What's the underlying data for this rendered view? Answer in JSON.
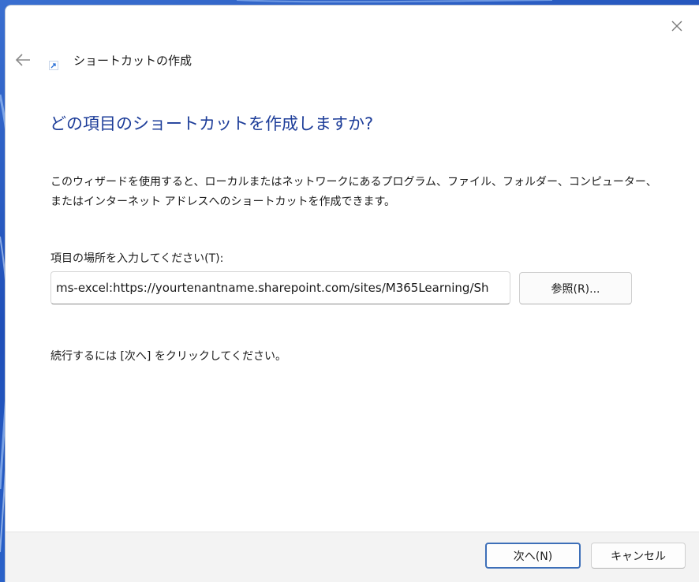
{
  "window": {
    "title": "ショートカットの作成",
    "close_icon": "close-icon",
    "back_icon": "back-arrow-icon",
    "title_icon": "shortcut-icon"
  },
  "main": {
    "heading": "どの項目のショートカットを作成しますか?",
    "description": "このウィザードを使用すると、ローカルまたはネットワークにあるプログラム、ファイル、フォルダー、コンピューター、またはインターネット アドレスへのショートカットを作成できます。",
    "location_label": "項目の場所を入力してください(T):",
    "location_value": "ms-excel:https://yourtenantname.sharepoint.com/sites/M365Learning/Sh",
    "browse_label": "参照(R)...",
    "hint": "続行するには [次へ] をクリックしてください。"
  },
  "footer": {
    "next_label": "次へ(N)",
    "cancel_label": "キャンセル"
  },
  "colors": {
    "heading": "#1d3d99",
    "default_button_border": "#3d6fb8",
    "footer_bg": "#f3f3f3"
  }
}
